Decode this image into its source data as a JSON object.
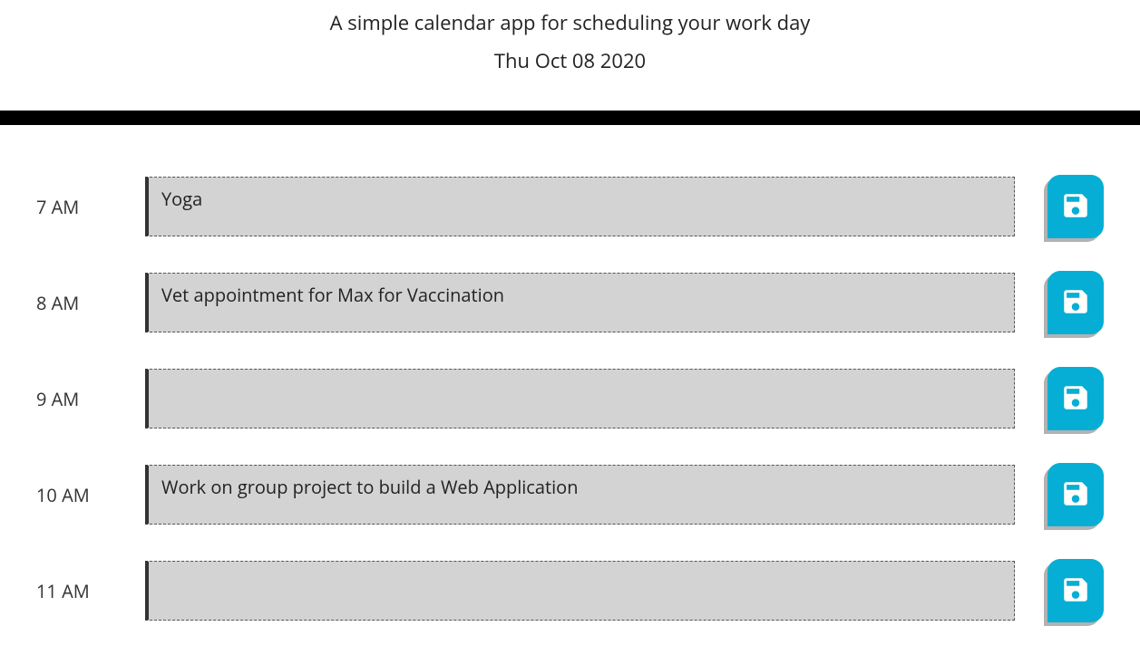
{
  "header": {
    "subtitle": "A simple calendar app for scheduling your work day",
    "date": "Thu Oct 08 2020"
  },
  "rows": [
    {
      "hour": "7 AM",
      "event": "Yoga"
    },
    {
      "hour": "8 AM",
      "event": "Vet appointment for Max for Vaccination"
    },
    {
      "hour": "9 AM",
      "event": ""
    },
    {
      "hour": "10 AM",
      "event": "Work on group project to build a Web Application"
    },
    {
      "hour": "11 AM",
      "event": ""
    }
  ]
}
